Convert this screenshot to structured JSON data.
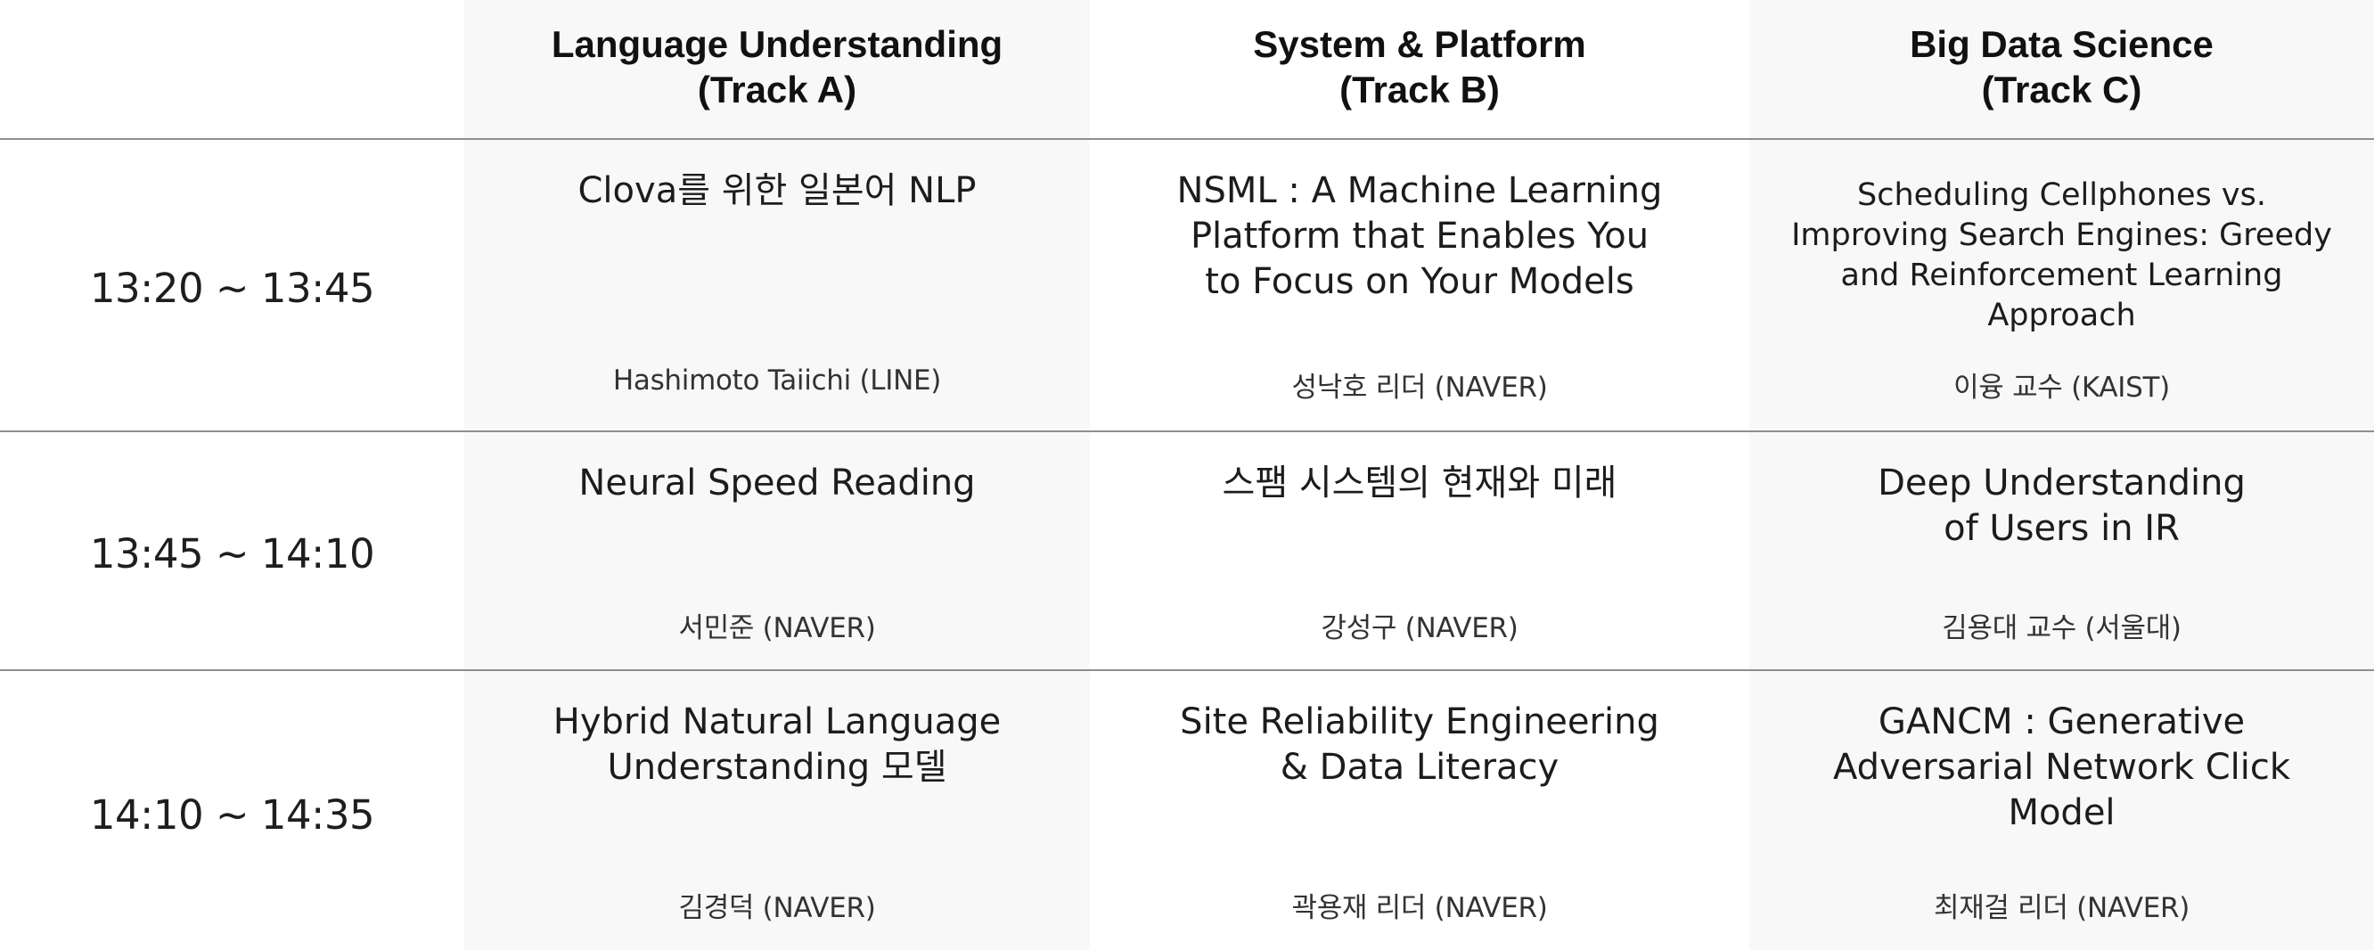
{
  "header": {
    "tracks": [
      {
        "line1": "Language Understanding",
        "line2": "(Track A)"
      },
      {
        "line1": "System & Platform",
        "line2": "(Track B)"
      },
      {
        "line1": "Big Data Science",
        "line2": "(Track C)"
      }
    ]
  },
  "rows": [
    {
      "time": "13:20 ~ 13:45",
      "sessions": [
        {
          "title": "Clova를 위한 일본어 NLP",
          "speaker": "Hashimoto Taiichi (LINE)"
        },
        {
          "title": "NSML : A Machine Learning Platform that Enables You to Focus on Your Models",
          "speaker": "성낙호 리더 (NAVER)"
        },
        {
          "title": "Scheduling Cellphones vs. Improving Search Engines: Greedy and Reinforcement Learning Approach",
          "speaker": "이융 교수 (KAIST)"
        }
      ]
    },
    {
      "time": "13:45 ~ 14:10",
      "sessions": [
        {
          "title": "Neural Speed Reading",
          "speaker": "서민준 (NAVER)"
        },
        {
          "title": "스팸 시스템의 현재와 미래",
          "speaker": "강성구 (NAVER)"
        },
        {
          "title": "Deep Understanding of Users in IR",
          "speaker": "김용대 교수 (서울대)"
        }
      ]
    },
    {
      "time": "14:10 ~ 14:35",
      "sessions": [
        {
          "title": "Hybrid Natural Language Understanding 모델",
          "speaker": "김경덕 (NAVER)"
        },
        {
          "title": "Site Reliability Engineering & Data Literacy",
          "speaker": "곽용재 리더 (NAVER)"
        },
        {
          "title": "GANCM : Generative Adversarial Network Click Model",
          "speaker": "최재걸 리더 (NAVER)"
        }
      ]
    }
  ]
}
